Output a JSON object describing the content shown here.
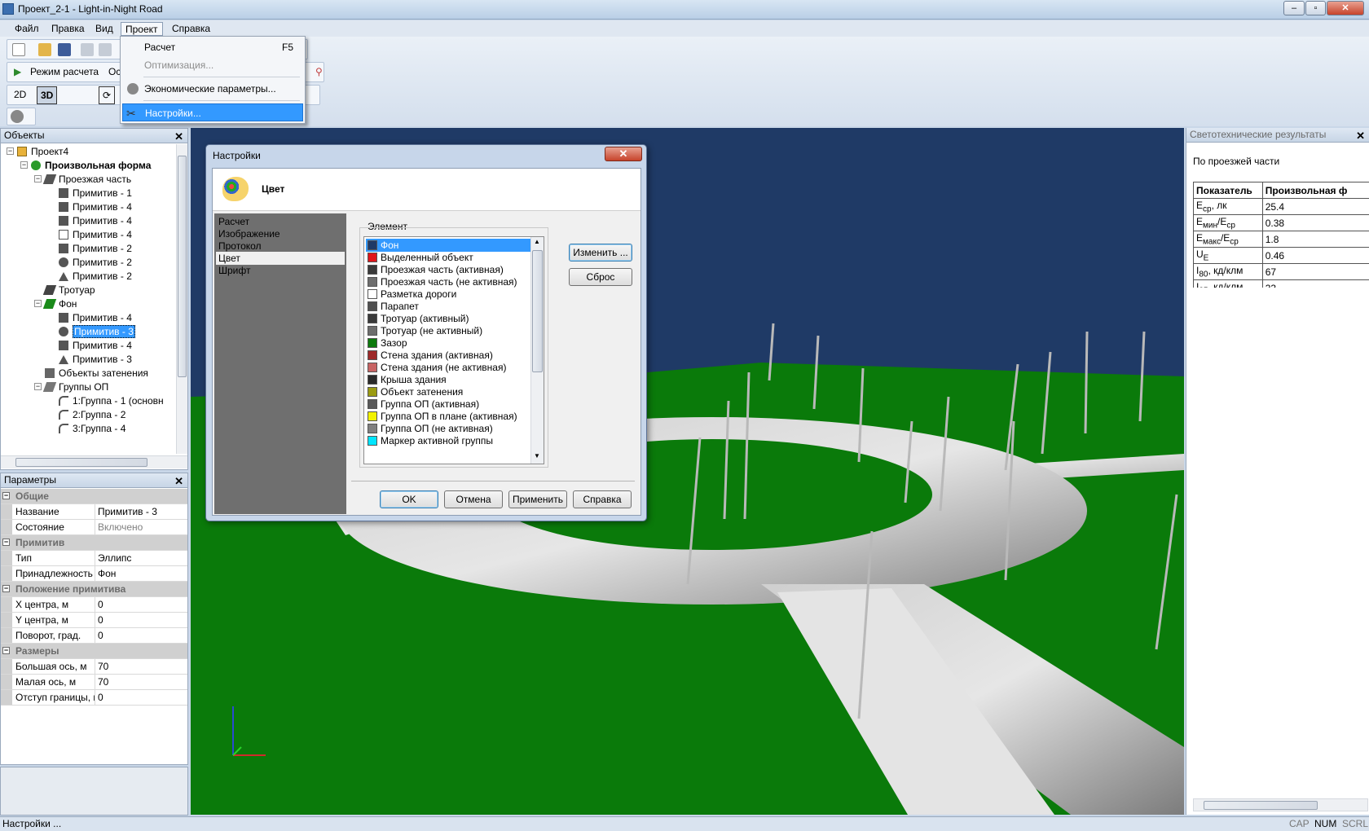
{
  "window": {
    "title": "Проект_2-1 - Light-in-Night Road"
  },
  "menubar": {
    "items": [
      "Файл",
      "Правка",
      "Вид",
      "Проект",
      "Справка"
    ]
  },
  "project_menu": {
    "items": [
      {
        "label": "Расчет",
        "shortcut": "F5",
        "state": "normal"
      },
      {
        "label": "Оптимизация...",
        "state": "disabled"
      },
      {
        "label": "Экономические параметры...",
        "state": "normal"
      },
      {
        "label": "Настройки...",
        "state": "selected"
      }
    ]
  },
  "toolbar": {
    "calc_mode": "Режим расчета",
    "axes": "Оси",
    "view2d": "2D",
    "view3d": "3D"
  },
  "objects_panel": {
    "title": "Объекты",
    "tree": [
      {
        "label": "Проект4",
        "level": 0,
        "icon": "project-icon"
      },
      {
        "label": "Произвольная форма",
        "level": 1,
        "icon": "freeform-icon",
        "bold": true
      },
      {
        "label": "Проезжая часть",
        "level": 2,
        "icon": "road-icon"
      },
      {
        "label": "Примитив - 1",
        "level": 3,
        "icon": "square-dark-icon"
      },
      {
        "label": "Примитив - 4",
        "level": 3,
        "icon": "square-dark-icon"
      },
      {
        "label": "Примитив - 4",
        "level": 3,
        "icon": "square-dark-icon"
      },
      {
        "label": "Примитив - 4",
        "level": 3,
        "icon": "square-white-icon"
      },
      {
        "label": "Примитив - 2",
        "level": 3,
        "icon": "square-dark-icon"
      },
      {
        "label": "Примитив - 2",
        "level": 3,
        "icon": "circle-dark-icon"
      },
      {
        "label": "Примитив - 2",
        "level": 3,
        "icon": "triangle-dark-icon"
      },
      {
        "label": "Тротуар",
        "level": 2,
        "icon": "sidewalk-icon"
      },
      {
        "label": "Фон",
        "level": 2,
        "icon": "background-icon"
      },
      {
        "label": "Примитив - 4",
        "level": 3,
        "icon": "square-dark-icon"
      },
      {
        "label": "Примитив - 3",
        "level": 3,
        "icon": "circle-dark-icon",
        "selected": true
      },
      {
        "label": "Примитив - 4",
        "level": 3,
        "icon": "square-dark-icon"
      },
      {
        "label": "Примитив - 3",
        "level": 3,
        "icon": "triangle-dark-icon"
      },
      {
        "label": "Объекты затенения",
        "level": 2,
        "icon": "shading-icon"
      },
      {
        "label": "Группы ОП",
        "level": 2,
        "icon": "lamp-groups-icon"
      },
      {
        "label": "1:Группа - 1 (основн",
        "level": 3,
        "icon": "lamp-icon"
      },
      {
        "label": "2:Группа - 2",
        "level": 3,
        "icon": "lamp-icon"
      },
      {
        "label": "3:Группа - 4",
        "level": 3,
        "icon": "lamp-icon"
      }
    ]
  },
  "params_panel": {
    "title": "Параметры",
    "rows": [
      {
        "type": "cat",
        "label": "Общие"
      },
      {
        "type": "row",
        "key": "Название",
        "value": "Примитив - 3"
      },
      {
        "type": "row",
        "key": "Состояние",
        "value": "Включено",
        "dim": true
      },
      {
        "type": "cat",
        "label": "Примитив"
      },
      {
        "type": "row",
        "key": "Тип",
        "value": "Эллипс"
      },
      {
        "type": "row",
        "key": "Принадлежность",
        "value": "Фон"
      },
      {
        "type": "cat",
        "label": "Положение примитива"
      },
      {
        "type": "row",
        "key": "X центра, м",
        "value": "0"
      },
      {
        "type": "row",
        "key": "Y центра, м",
        "value": "0"
      },
      {
        "type": "row",
        "key": "Поворот, град.",
        "value": "0"
      },
      {
        "type": "cat",
        "label": "Размеры"
      },
      {
        "type": "row",
        "key": "Большая ось, м",
        "value": "70"
      },
      {
        "type": "row",
        "key": "Малая ось, м",
        "value": "70"
      },
      {
        "type": "row",
        "key": "Отступ границы, м",
        "value": "0"
      }
    ]
  },
  "results_panel": {
    "title": "Светотехнические результаты",
    "subtitle": "По проезжей части",
    "headers": [
      "Показатель",
      "Произвольная ф"
    ],
    "rows": [
      {
        "main": "E",
        "sub": "ср",
        "tail": ", лк",
        "value": "25.4"
      },
      {
        "main": "E",
        "sub": "мин",
        "tail": "/E",
        "sub2": "ср",
        "value": "0.38"
      },
      {
        "main": "E",
        "sub": "макс",
        "tail": "/E",
        "sub2": "ср",
        "value": "1.8"
      },
      {
        "main": "U",
        "sub": "E",
        "tail": "",
        "value": "0.46"
      },
      {
        "main": "I",
        "sub": "80",
        "tail": ", кд/клм",
        "value": "67"
      },
      {
        "main": "I",
        "sub": "85",
        "tail": ", кд/клм",
        "value": "33"
      }
    ]
  },
  "dialog": {
    "title": "Настройки",
    "section_title": "Цвет",
    "categories": [
      "Расчет",
      "Изображение",
      "Протокол",
      "Цвет",
      "Шрифт"
    ],
    "selected_category": "Цвет",
    "element_group_label": "Элемент",
    "elements": [
      {
        "label": "Фон",
        "color": "#1f3a66",
        "selected": true
      },
      {
        "label": "Выделенный объект",
        "color": "#e0151a"
      },
      {
        "label": "Проезжая часть (активная)",
        "color": "#3a3a3a"
      },
      {
        "label": "Проезжая часть (не активная)",
        "color": "#6e6e6e"
      },
      {
        "label": "Разметка дороги",
        "color": "#ffffff"
      },
      {
        "label": "Парапет",
        "color": "#505050"
      },
      {
        "label": "Тротуар (активный)",
        "color": "#3a3a3a"
      },
      {
        "label": "Тротуар (не активный)",
        "color": "#6e6e6e"
      },
      {
        "label": "Зазор",
        "color": "#0d7a0d"
      },
      {
        "label": "Стена здания (активная)",
        "color": "#9e2a2a"
      },
      {
        "label": "Стена здания (не активная)",
        "color": "#c86464"
      },
      {
        "label": "Крыша здания",
        "color": "#2a2a2a"
      },
      {
        "label": "Объект затенения",
        "color": "#9b9b12"
      },
      {
        "label": "Группа ОП (активная)",
        "color": "#5a5a5a"
      },
      {
        "label": "Группа ОП в плане (активная)",
        "color": "#f2f200"
      },
      {
        "label": "Группа ОП (не активная)",
        "color": "#808080"
      },
      {
        "label": "Маркер активной группы",
        "color": "#00e5ff"
      }
    ],
    "buttons": {
      "change": "Изменить ...",
      "reset": "Сброс",
      "ok": "OK",
      "cancel": "Отмена",
      "apply": "Применить",
      "help": "Справка"
    }
  },
  "statusbar": {
    "text": "Настройки ...",
    "indicators": [
      "CAP",
      "NUM",
      "SCRL"
    ]
  },
  "colors": {
    "ground": "#0a7a0a",
    "sky": "#1f3a66",
    "road": "#9a9a9a",
    "selection": "#3399ff"
  }
}
